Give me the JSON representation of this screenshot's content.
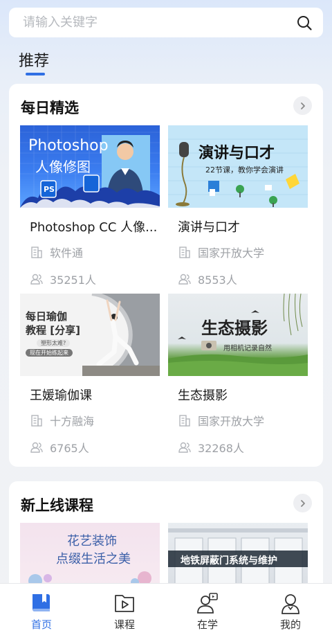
{
  "search": {
    "placeholder": "请输入关键字"
  },
  "tabs": {
    "recommend": "推荐"
  },
  "daily": {
    "title": "每日精选",
    "courses": [
      {
        "title": "Photoshop CC 人像...",
        "org": "软件通",
        "count": "35251人",
        "thumb": {
          "line1": "Photoshop",
          "line2": "人像修图",
          "badge": "PS"
        }
      },
      {
        "title": "演讲与口才",
        "org": "国家开放大学",
        "count": "8553人",
        "thumb": {
          "line1": "演讲与口才",
          "line2": "22节课，教你学会演讲"
        }
      },
      {
        "title": "王媛瑜伽课",
        "org": "十方融海",
        "count": "6765人",
        "thumb": {
          "line1": "每日瑜伽",
          "line2": "教程 [分享]",
          "tag1": "塑形太难?",
          "tag2": "现在开始练起来"
        }
      },
      {
        "title": "生态摄影",
        "org": "国家开放大学",
        "count": "32268人",
        "thumb": {
          "line1": "生态摄影",
          "line2": "用相机记录自然"
        }
      }
    ]
  },
  "new_courses": {
    "title": "新上线课程",
    "courses": [
      {
        "thumb": {
          "line1": "花艺装饰",
          "line2": "点缀生活之美"
        }
      },
      {
        "thumb": {
          "line1": "地铁屏蔽门系统与维护"
        }
      }
    ]
  },
  "tabbar": {
    "items": [
      {
        "label": "首页",
        "icon": "home-book-icon",
        "active": true
      },
      {
        "label": "课程",
        "icon": "course-play-icon",
        "active": false
      },
      {
        "label": "在学",
        "icon": "learning-person-icon",
        "active": false
      },
      {
        "label": "我的",
        "icon": "profile-person-icon",
        "active": false
      }
    ]
  },
  "colors": {
    "accent": "#2f6fe4",
    "meta_gray": "#9ea1a6"
  }
}
